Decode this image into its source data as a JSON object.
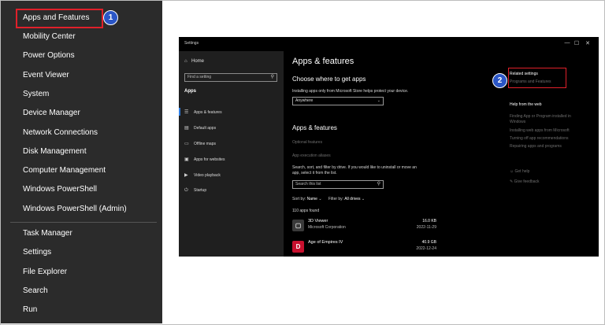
{
  "winx_menu": {
    "items": [
      "Apps and Features",
      "Mobility Center",
      "Power Options",
      "Event Viewer",
      "System",
      "Device Manager",
      "Network Connections",
      "Disk Management",
      "Computer Management",
      "Windows PowerShell",
      "Windows PowerShell (Admin)",
      "Task Manager",
      "Settings",
      "File Explorer",
      "Search",
      "Run"
    ]
  },
  "badges": {
    "one": "1",
    "two": "2"
  },
  "settings": {
    "window_title": "Settings",
    "controls": {
      "minimize": "—",
      "maximize": "☐",
      "close": "✕"
    },
    "nav": {
      "home": "Home",
      "find_placeholder": "Find a setting",
      "section": "Apps",
      "items": [
        "Apps & features",
        "Default apps",
        "Offline maps",
        "Apps for websites",
        "Video playback",
        "Startup"
      ]
    },
    "main": {
      "title": "Apps & features",
      "choose_heading": "Choose where to get apps",
      "choose_desc": "Installing apps only from Microsoft Store helps protect your device.",
      "dropdown_value": "Anywhere",
      "section_heading": "Apps & features",
      "optional_features": "Optional features",
      "app_execution_aliases": "App execution aliases",
      "search_desc_line1": "Search, sort, and filter by drive. If you would like to uninstall or move an",
      "search_desc_line2": "app, select it from the list.",
      "search_placeholder": "Search this list",
      "sort_label": "Sort by:",
      "sort_value": "Name",
      "filter_label": "Filter by:",
      "filter_value": "All drives",
      "apps_found": "110 apps found",
      "apps": [
        {
          "name": "3D Viewer",
          "publisher": "Microsoft Corporation",
          "size": "16.0 KB",
          "date": "2022-11-29"
        },
        {
          "name": "Age of Empires IV",
          "publisher": "",
          "size": "40.9 GB",
          "date": "2022-12-24"
        }
      ]
    },
    "side": {
      "related_heading": "Related settings",
      "programs_and_features": "Programs and Features",
      "help_heading": "Help from the web",
      "help_links": [
        "Finding App or Program installed in",
        "Windows",
        "Installing web apps from Microsoft",
        "Turning off app recommendations",
        "Repairing apps and programs"
      ],
      "get_help": "Get help",
      "give_feedback": "Give feedback"
    }
  },
  "colors": {
    "highlight_red": "#e0202a",
    "badge_blue": "#2b56c6",
    "menu_bg": "#2b2b2b"
  }
}
